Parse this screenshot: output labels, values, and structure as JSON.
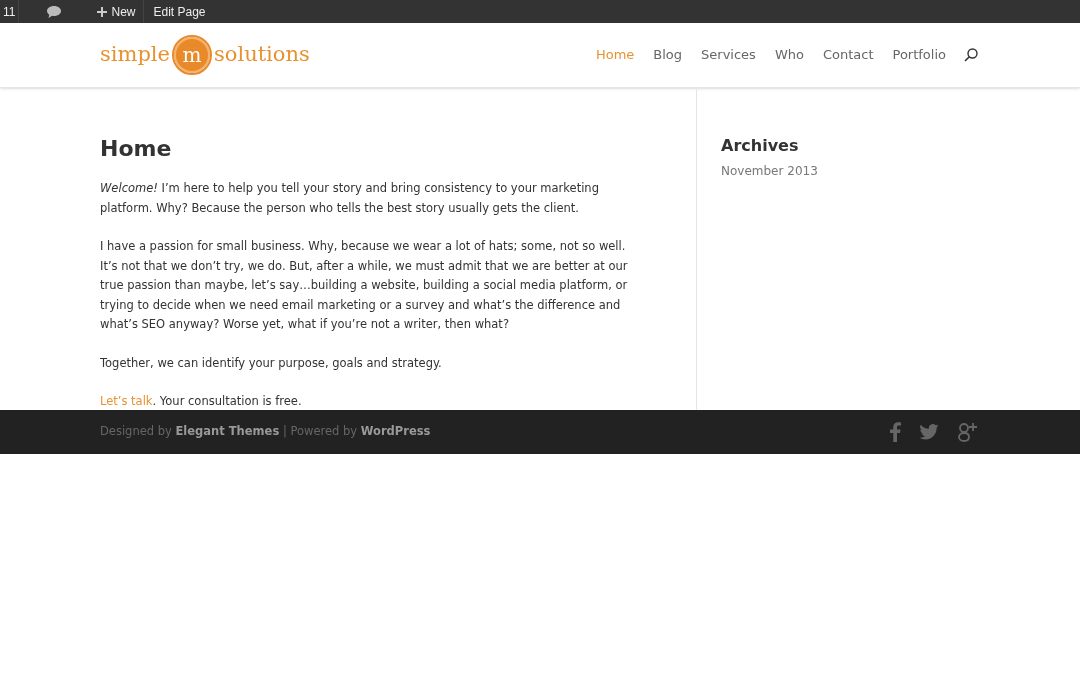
{
  "admin_bar": {
    "count": "11",
    "new_label": "New",
    "edit_label": "Edit Page"
  },
  "logo": {
    "left": "simple",
    "mark": "m",
    "right": "solutions"
  },
  "nav": [
    {
      "label": "Home",
      "selected": true
    },
    {
      "label": "Blog",
      "selected": false
    },
    {
      "label": "Services",
      "selected": false
    },
    {
      "label": "Who",
      "selected": false
    },
    {
      "label": "Contact",
      "selected": false
    },
    {
      "label": "Portfolio",
      "selected": false
    }
  ],
  "page": {
    "title": "Home",
    "paragraphs": [
      [
        {
          "kind": "text",
          "text": "*Welcome!* I’m here to help you tell your story and bring consistency to your marketing platform. Why? Because the person who tells the best story usually gets the client."
        }
      ],
      [
        {
          "kind": "text",
          "text": "I have a passion for small business. Why, because we wear a lot of hats; some, not so well. It’s not that we don’t try, we do. But, after a while, we must admit that we are better at our true passion than maybe, let’s say…building a website, building a social media platform, or trying to decide when we need email marketing or a survey and what’s the difference and what’s SEO anyway? Worse yet, what if you’re not a writer, then what?"
        }
      ],
      [
        {
          "kind": "text",
          "text": "Together, we can identify your purpose, goals and strategy."
        }
      ],
      [
        {
          "kind": "link",
          "text": "Let’s talk"
        },
        {
          "kind": "text",
          "text": ". Your consultation is free."
        }
      ]
    ]
  },
  "sidebar": {
    "title": "Archives",
    "items": [
      "November 2013"
    ]
  },
  "footer": {
    "credits": [
      {
        "kind": "text",
        "text": "Designed by "
      },
      {
        "kind": "link",
        "text": "Elegant Themes"
      },
      {
        "kind": "text",
        "text": " | Powered by "
      },
      {
        "kind": "link",
        "text": "WordPress"
      }
    ]
  }
}
